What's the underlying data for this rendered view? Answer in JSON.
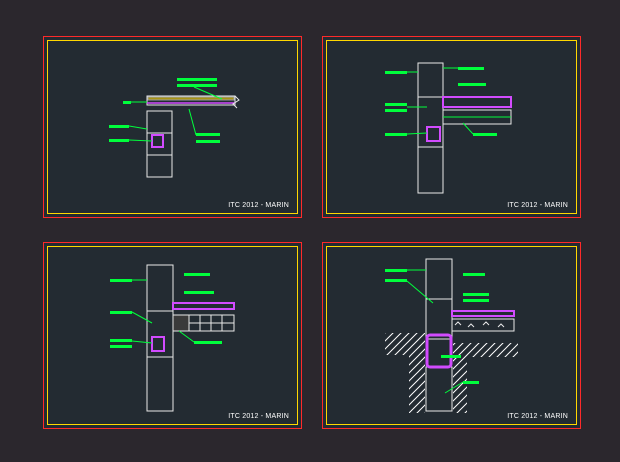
{
  "workspace": {
    "background": "#2b272d",
    "sheet_background": "#232b32",
    "outer_border_color": "#ff2a2a",
    "inner_border_color": "#ffd800",
    "leader_color": "#00ff3c",
    "insulation_color": "#d24bff",
    "hatch_color": "#ffffff"
  },
  "sheets": [
    {
      "id": "detail-1",
      "stamp": "ITC 2012 - MARIN"
    },
    {
      "id": "detail-2",
      "stamp": "ITC 2012 - MARIN"
    },
    {
      "id": "detail-3",
      "stamp": "ITC 2012 - MARIN"
    },
    {
      "id": "detail-4",
      "stamp": "ITC 2012 - MARIN"
    }
  ]
}
